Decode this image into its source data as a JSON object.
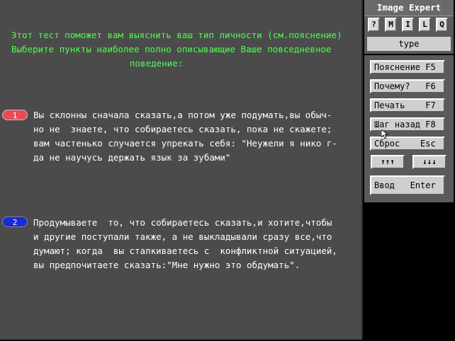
{
  "intro": {
    "line1": "Этот тест поможет вам выяснить ваш тип личности (см.пояснение)",
    "line2": "Выберите пункты наиболее полно описывающие Ваше повседневное",
    "line3": "поведение:"
  },
  "questions": [
    {
      "number": "1",
      "lines": [
        "Вы склонны сначала сказать,а потом уже подумать,вы обыч-",
        "но не  знаете, что собираетесь сказать, пока не скажете;",
        "вам частенько случается упрекать себя: \"Неужели я нико г-",
        "да не научусь держать язык за зубами\""
      ]
    },
    {
      "number": "2",
      "lines": [
        "Продумываете  то, что собираетесь сказать,и хотите,чтобы",
        "и другие поступали также, а не выкладывали сразу все,что",
        "думают; когда  вы сталкиваетесь с  конфликтной ситуацией,",
        "вы предпочитаете сказать:\"Мне нужно это обдумать\"."
      ]
    }
  ],
  "sidebar": {
    "title": "Image Expert",
    "small_buttons": [
      "?",
      "M",
      "I",
      "L",
      "Q"
    ],
    "type_label": "type",
    "buttons": [
      {
        "label": "Пояснение F5"
      },
      {
        "label": "Почему?   F6"
      },
      {
        "label": "Печать    F7"
      },
      {
        "label": "Шаг назад F8"
      },
      {
        "label": "Сброс    Esc"
      }
    ],
    "arrow_up": "↑↑↑",
    "arrow_down": "↓↓↓",
    "enter_label": "Ввод   Enter"
  },
  "colors": {
    "intro_text": "#4cff4c",
    "main_bg": "#4b4b4b",
    "badge1": "#e84b57",
    "badge2": "#1a2ad6"
  }
}
